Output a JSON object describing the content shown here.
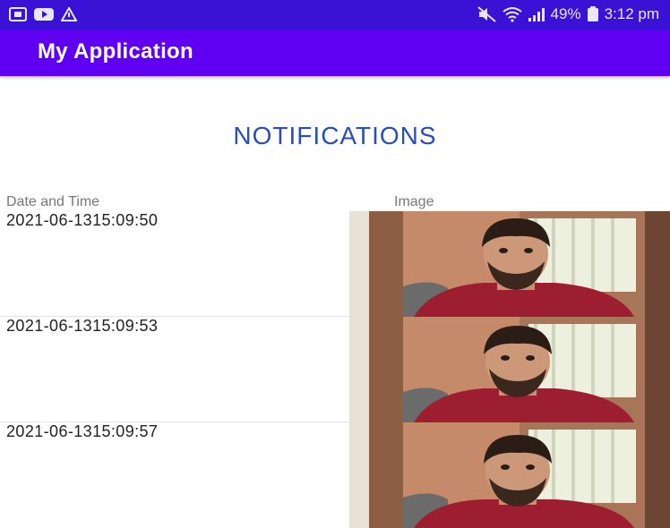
{
  "status_bar": {
    "left_icons": [
      "screen-record-icon",
      "youtube-icon",
      "warning-icon"
    ],
    "right_icons": [
      "mute-icon",
      "wifi-icon",
      "signal-icon",
      "battery-icon"
    ],
    "battery": "49%",
    "time": "3:12 pm"
  },
  "app_bar": {
    "title": "My Application"
  },
  "page": {
    "heading": "NOTIFICATIONS"
  },
  "table": {
    "headers": {
      "date": "Date and Time",
      "image": "Image"
    },
    "rows": [
      {
        "datetime": "2021-06-1315:09:50",
        "image": "webcam-photo"
      },
      {
        "datetime": "2021-06-1315:09:53",
        "image": "webcam-photo"
      },
      {
        "datetime": "2021-06-1315:09:57",
        "image": "webcam-photo"
      }
    ]
  },
  "colors": {
    "status_bar": "#3a12d6",
    "app_bar": "#5f00f2",
    "heading": "#2a4db8"
  }
}
